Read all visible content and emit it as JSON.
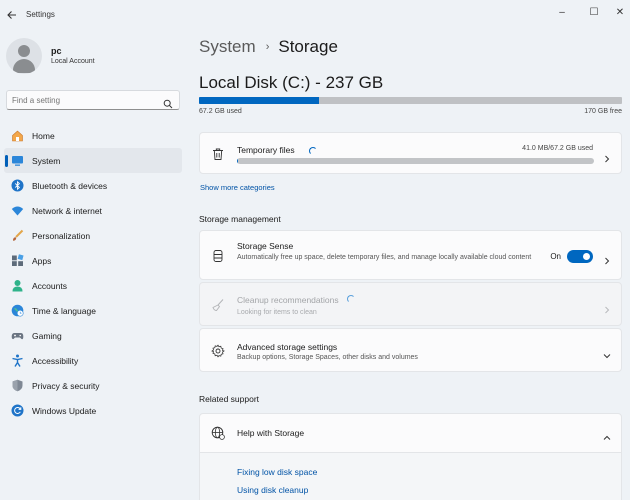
{
  "window": {
    "title": "Settings",
    "minimize": "–",
    "maximize": "☐",
    "close": "✕"
  },
  "profile": {
    "name": "pc",
    "account_type": "Local Account"
  },
  "search": {
    "placeholder": "Find a setting",
    "value": ""
  },
  "sidebar": {
    "items": [
      {
        "label": "Home",
        "icon": "home-icon"
      },
      {
        "label": "System",
        "icon": "system-icon",
        "active": true
      },
      {
        "label": "Bluetooth & devices",
        "icon": "bluetooth-icon"
      },
      {
        "label": "Network & internet",
        "icon": "wifi-icon"
      },
      {
        "label": "Personalization",
        "icon": "brush-icon"
      },
      {
        "label": "Apps",
        "icon": "apps-icon"
      },
      {
        "label": "Accounts",
        "icon": "accounts-icon"
      },
      {
        "label": "Time & language",
        "icon": "globe-icon"
      },
      {
        "label": "Gaming",
        "icon": "gamepad-icon"
      },
      {
        "label": "Accessibility",
        "icon": "accessibility-icon"
      },
      {
        "label": "Privacy & security",
        "icon": "shield-icon"
      },
      {
        "label": "Windows Update",
        "icon": "update-icon"
      }
    ]
  },
  "breadcrumb": {
    "parent": "System",
    "separator": "›",
    "current": "Storage"
  },
  "disk": {
    "title": "Local Disk (C:) - 237 GB",
    "used_label": "67.2 GB used",
    "free_label": "170 GB free",
    "used_fraction": 0.284
  },
  "temporary_files": {
    "title": "Temporary files",
    "amount": "41.0 MB/67.2 GB used",
    "used_fraction": 0.0006
  },
  "show_more_categories": "Show more categories",
  "storage_management": {
    "heading": "Storage management",
    "storage_sense": {
      "title": "Storage Sense",
      "description": "Automatically free up space, delete temporary files, and manage locally available cloud content",
      "toggle_state": "On",
      "enabled": true
    },
    "cleanup": {
      "title": "Cleanup recommendations",
      "description": "Looking for items to clean",
      "disabled": true
    },
    "advanced": {
      "title": "Advanced storage settings",
      "description": "Backup options, Storage Spaces, other disks and volumes"
    }
  },
  "related_support": {
    "heading": "Related support",
    "help": {
      "title": "Help with Storage",
      "links": [
        "Fixing low disk space",
        "Using disk cleanup"
      ]
    }
  },
  "colors": {
    "accent": "#0067c0",
    "link": "#0053a6",
    "background": "#eef2f6"
  }
}
